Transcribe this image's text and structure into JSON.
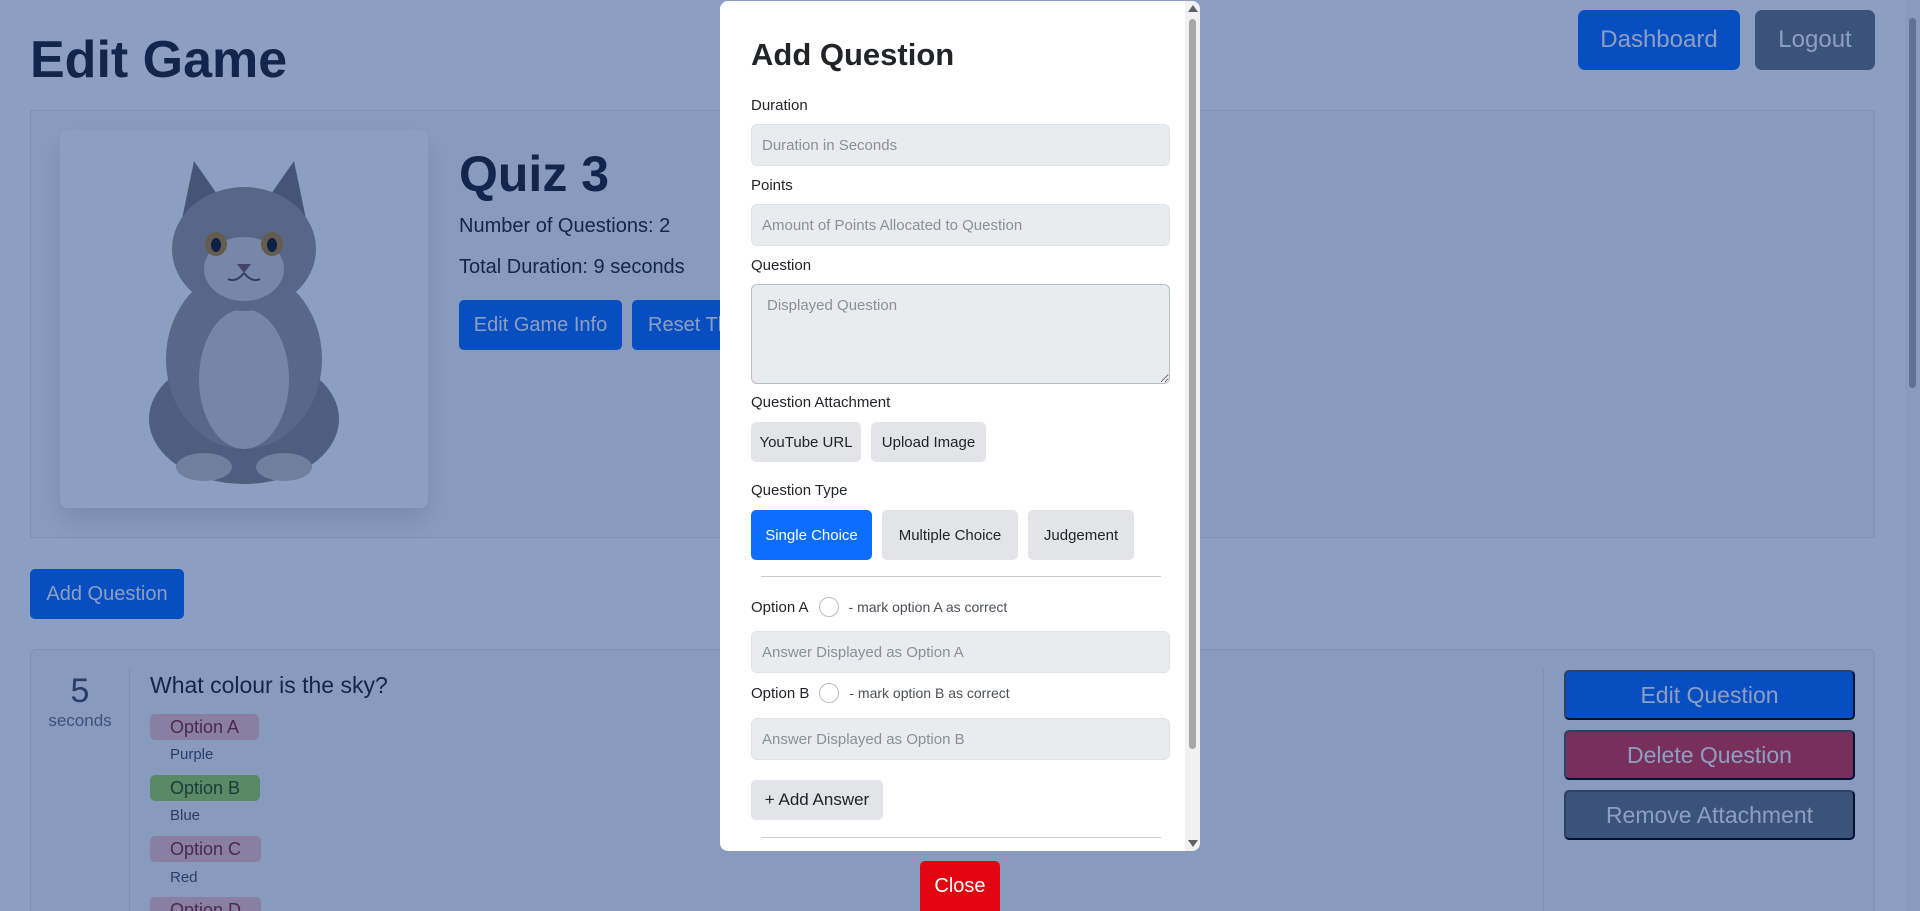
{
  "page": {
    "title": "Edit Game",
    "nav": {
      "dashboard_label": "Dashboard",
      "logout_label": "Logout"
    }
  },
  "game": {
    "name": "Quiz 3",
    "num_questions_label": "Number of Questions: 2",
    "total_duration_label": "Total Duration: 9 seconds",
    "edit_info_label": "Edit Game Info",
    "reset_label": "Reset Th",
    "add_question_label": "Add Question"
  },
  "question": {
    "duration": "5",
    "duration_unit": "seconds",
    "text": "What colour is the sky?",
    "options": [
      {
        "label": "Option A",
        "answer": "Purple",
        "correct": false
      },
      {
        "label": "Option B",
        "answer": "Blue",
        "correct": true
      },
      {
        "label": "Option C",
        "answer": "Red",
        "correct": false
      },
      {
        "label": "Option D",
        "answer": "",
        "correct": false
      }
    ],
    "edit_label": "Edit Question",
    "delete_label": "Delete Question",
    "remove_attachment_label": "Remove Attachment"
  },
  "modal": {
    "title": "Add Question",
    "duration_label": "Duration",
    "duration_placeholder": "Duration in Seconds",
    "points_label": "Points",
    "points_placeholder": "Amount of Points Allocated to Question",
    "question_label": "Question",
    "question_placeholder": "Displayed Question",
    "attachment_label": "Question Attachment",
    "youtube_label": "YouTube URL",
    "upload_label": "Upload Image",
    "type_label": "Question Type",
    "types": [
      "Single Choice",
      "Multiple Choice",
      "Judgement"
    ],
    "active_type": "Single Choice",
    "option_a_label": "Option A",
    "option_a_mark": "- mark option A as correct",
    "option_a_placeholder": "Answer Displayed as Option A",
    "option_b_label": "Option B",
    "option_b_mark": "- mark option B as correct",
    "option_b_placeholder": "Answer Displayed as Option B",
    "add_answer_label": "+ Add Answer",
    "close_label": "Close"
  },
  "colors": {
    "primary": "#0d6efd",
    "secondary": "#6c757d",
    "danger": "#dc3545",
    "close": "#e20613",
    "correct_badge": "#a5d957",
    "wrong_badge": "#f8c6c6"
  }
}
